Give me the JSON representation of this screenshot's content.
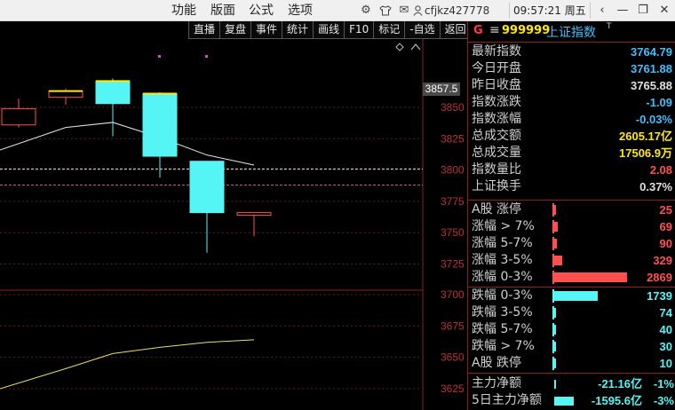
{
  "menu": {
    "items": [
      "功能",
      "版面",
      "公式",
      "选项"
    ]
  },
  "topbar": {
    "icons": [
      "settings-icon",
      "shirt-icon",
      "mail-icon",
      "user-icon"
    ],
    "user": "cfjkz427778",
    "clock": "09:57:21 周五",
    "window_buttons": [
      "‹",
      "—",
      "❐",
      "✕"
    ]
  },
  "toolbar": [
    "直播",
    "复盘",
    "事件",
    "统计",
    "画线",
    "F10",
    "标记",
    "-自选",
    "返回"
  ],
  "stock": {
    "flag": "G",
    "code": "999999",
    "name": "上证指数",
    "sup": "T"
  },
  "stats": [
    {
      "label": "最新指数",
      "value": "3764.79",
      "color": "#3fbfff"
    },
    {
      "label": "今日开盘",
      "value": "3761.88",
      "color": "#3fbfff"
    },
    {
      "label": "昨日收盘",
      "value": "3765.88",
      "color": "#e0e0e0"
    },
    {
      "label": "指数涨跌",
      "value": "-1.09",
      "color": "#3fbfff"
    },
    {
      "label": "指数涨幅",
      "value": "-0.03%",
      "color": "#3fbfff"
    },
    {
      "label": "总成交额",
      "value": "2605.17亿",
      "color": "#ffea00"
    },
    {
      "label": "总成交量",
      "value": "17506.9万",
      "color": "#ffea00"
    },
    {
      "label": "指数量比",
      "value": "2.08",
      "color": "#ff5050"
    },
    {
      "label": "上证换手",
      "value": "0.37%",
      "color": "#e0e0e0"
    }
  ],
  "breadth_up": [
    {
      "label": "A股 涨停",
      "value": "25",
      "ratio": 0.02
    },
    {
      "label": "涨幅 > 7%",
      "value": "69",
      "ratio": 0.05
    },
    {
      "label": "涨幅 5-7%",
      "value": "90",
      "ratio": 0.04
    },
    {
      "label": "涨幅 3-5%",
      "value": "329",
      "ratio": 0.11
    },
    {
      "label": "涨幅 0-3%",
      "value": "2869",
      "ratio": 1.0
    }
  ],
  "breadth_down": [
    {
      "label": "跌幅 0-3%",
      "value": "1739",
      "ratio": 0.6
    },
    {
      "label": "跌幅 3-5%",
      "value": "74",
      "ratio": 0.03
    },
    {
      "label": "跌幅 5-7%",
      "value": "40",
      "ratio": 0.015
    },
    {
      "label": "跌幅 > 7%",
      "value": "30",
      "ratio": 0.01
    },
    {
      "label": "A股 跌停",
      "value": "10",
      "ratio": 0.005
    }
  ],
  "flows": [
    {
      "label": "主力净额",
      "amount": "-21.16亿",
      "pct": "-1%",
      "ratio": 0.02
    },
    {
      "label": "5日主力净额",
      "amount": "-1595.6亿",
      "pct": "-3%",
      "ratio": 0.27
    }
  ],
  "colors": {
    "up": "#ff5050",
    "down": "#55f5f5",
    "yellow": "#ffea00",
    "grid": "#8a2020"
  },
  "chart_data": {
    "type": "candlestick",
    "current_price_label": "3857.5",
    "y_ticks_upper": [
      "3850",
      "3825",
      "3800",
      "3775",
      "3750",
      "3725"
    ],
    "y_ticks_lower": [
      "3700",
      "3675",
      "3650",
      "3625"
    ],
    "candles": [
      {
        "open": 3836,
        "high": 3857,
        "low": 3834,
        "close": 3849
      },
      {
        "open": 3863,
        "high": 3865,
        "low": 3852,
        "close": 3858
      },
      {
        "open": 3871,
        "high": 3873,
        "low": 3827,
        "close": 3853
      },
      {
        "open": 3861,
        "high": 3862,
        "low": 3794,
        "close": 3811
      },
      {
        "open": 3807,
        "high": 3807,
        "low": 3734,
        "close": 3766
      },
      {
        "open": 3766,
        "high": 3766,
        "low": 3747,
        "close": 3764
      }
    ],
    "ma": [
      3816,
      3834,
      3838,
      3826,
      3812,
      3804
    ],
    "lower_line": [
      3625,
      3641,
      3653,
      3658,
      3662,
      3664
    ]
  }
}
